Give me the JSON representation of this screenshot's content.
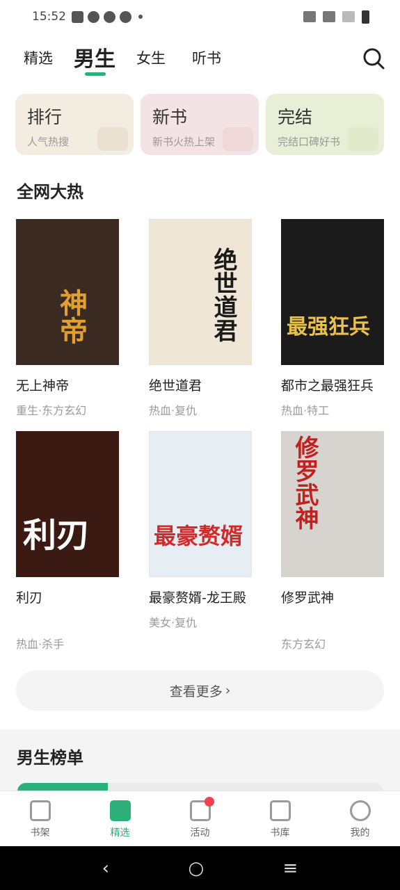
{
  "status_bar": {
    "time": "15:52"
  },
  "top_tabs": [
    {
      "label": "精选"
    },
    {
      "label": "男生"
    },
    {
      "label": "女生"
    },
    {
      "label": "听书"
    }
  ],
  "category_cards": [
    {
      "title": "排行",
      "subtitle": "人气热搜",
      "color": "#f3ece0"
    },
    {
      "title": "新书",
      "subtitle": "新书火热上架",
      "color": "#f3e3e4"
    },
    {
      "title": "完结",
      "subtitle": "完结口碑好书",
      "color": "#e9efd6"
    }
  ],
  "hot_section": {
    "title": "全网大热",
    "books": [
      {
        "title": "无上神帝",
        "tags": "重生·东方玄幻",
        "cover_text": "神帝",
        "cover_bg": "#3a2a22",
        "cover_fg": "#e0a030"
      },
      {
        "title": "绝世道君",
        "tags": "热血·复仇",
        "cover_text": "绝世道君",
        "cover_bg": "#efe6d6",
        "cover_fg": "#1a1a1a"
      },
      {
        "title": "都市之最强狂兵",
        "tags": "热血·特工",
        "cover_text": "最强狂兵",
        "cover_bg": "#1b1b1b",
        "cover_fg": "#e8c24a"
      },
      {
        "title": "利刃",
        "tags": "热血·杀手",
        "cover_text": "利刃",
        "cover_bg": "#3b1a14",
        "cover_fg": "#ffffff"
      },
      {
        "title": "最豪赘婿-龙王殿",
        "tags": "美女·复仇",
        "cover_text": "最豪赘婿",
        "cover_bg": "#e6eef4",
        "cover_fg": "#d22a2a"
      },
      {
        "title": "修罗武神",
        "tags": "东方玄幻",
        "cover_text": "修罗武神",
        "cover_bg": "#d7d3cf",
        "cover_fg": "#c02020"
      }
    ],
    "more_label": "查看更多"
  },
  "rank_section": {
    "title": "男生榜单"
  },
  "bottom_nav": [
    {
      "label": "书架",
      "icon": "bookshelf-icon"
    },
    {
      "label": "精选",
      "icon": "featured-icon"
    },
    {
      "label": "活动",
      "icon": "gift-icon"
    },
    {
      "label": "书库",
      "icon": "library-icon"
    },
    {
      "label": "我的",
      "icon": "profile-icon"
    }
  ],
  "colors": {
    "accent": "#2bb07a",
    "badge": "#f0424a"
  }
}
